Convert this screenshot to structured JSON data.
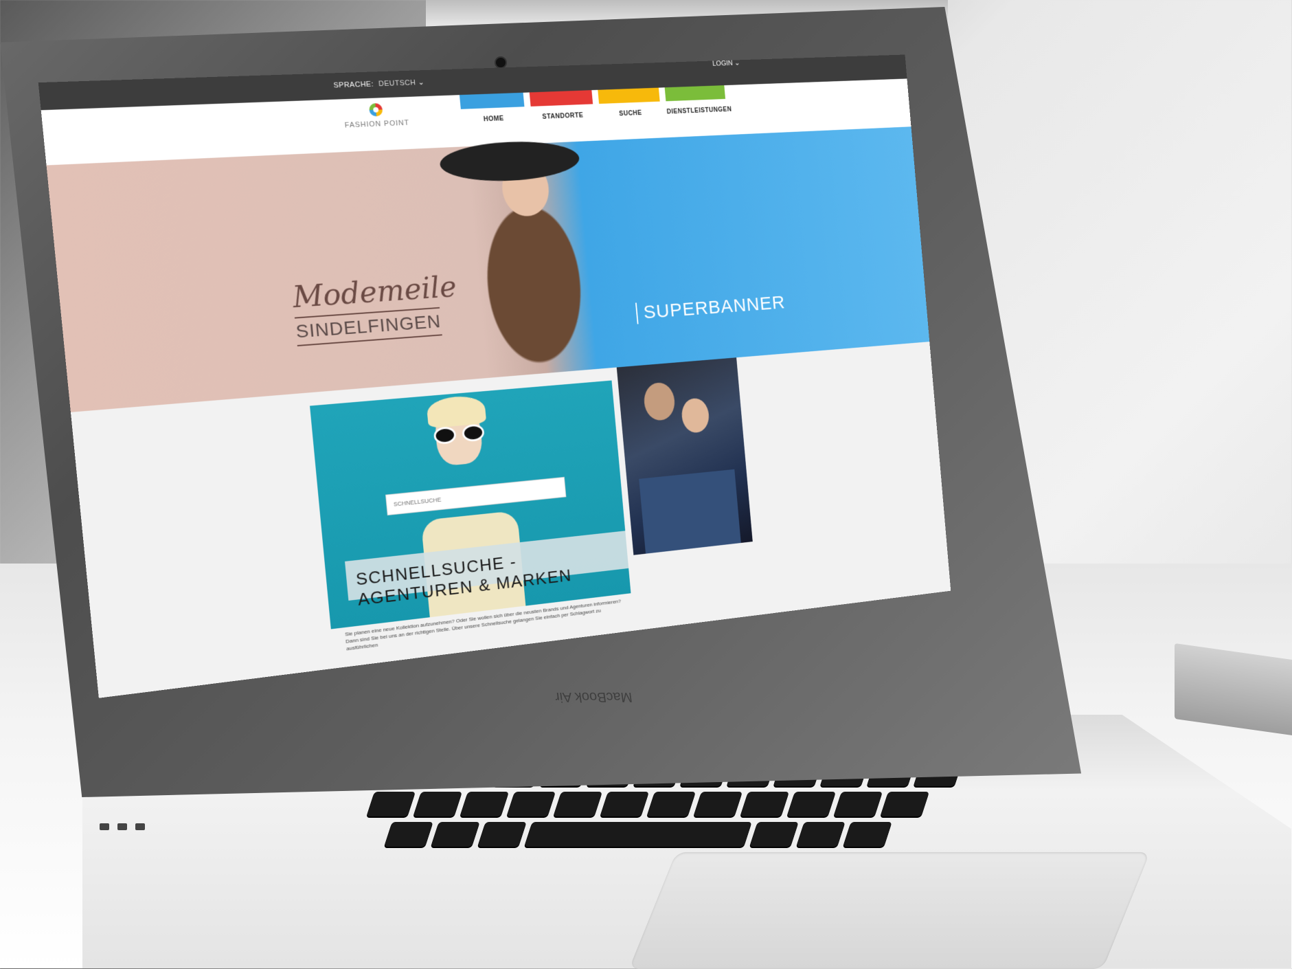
{
  "device": {
    "brand_label": "MacBook Air"
  },
  "site": {
    "util_bar": {
      "language_label": "SPRACHE:",
      "language_value": "DEUTSCH",
      "login_label": "LOGIN"
    },
    "logo_text": "FASHION POINT",
    "nav": [
      {
        "label": "HOME",
        "color": "#3aa0e0"
      },
      {
        "label": "STANDORTE",
        "color": "#e53935"
      },
      {
        "label": "SUCHE",
        "color": "#f7b90b"
      },
      {
        "label": "DIENSTLEISTUNGEN",
        "color": "#7bbd3a"
      }
    ],
    "hero": {
      "left_script": "Modemeile",
      "left_subtitle": "SINDELFINGEN",
      "right_title": "SUPERBANNER"
    },
    "search_tile": {
      "input_placeholder": "SCHNELLSUCHE",
      "banner_text": "SCHNELLSUCHE - AGENTUREN & MARKEN",
      "description": "Sie planen eine neue Kollektion aufzunehmen? Oder Sie wollen sich über die neusten Brands und Agenturen informieren? Dann sind Sie bei uns an der richtigen Stelle. Über unsere Schnellsuche gelangen Sie einfach per Schlagwort zu ausführlichen"
    }
  }
}
